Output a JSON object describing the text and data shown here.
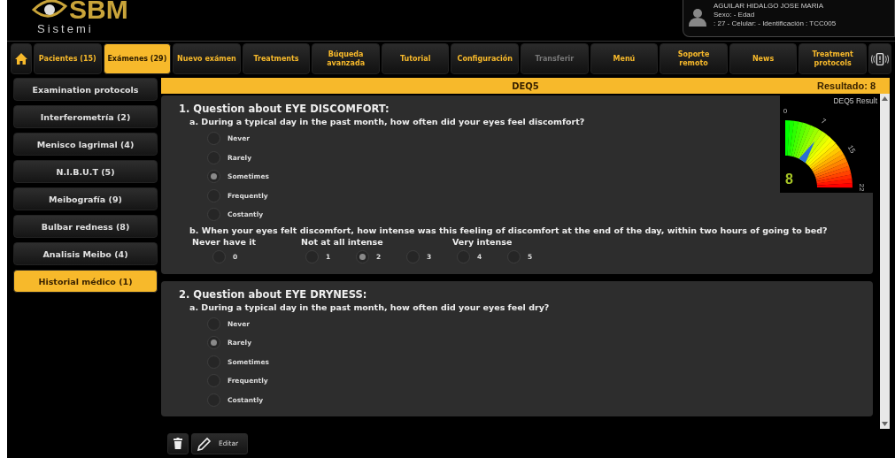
{
  "logo": {
    "name": "SBM",
    "subtitle": "Sistemi"
  },
  "patient": {
    "name": "AGUILAR HIDALGO JOSE MARIA",
    "lines": [
      "Sexo:  - Edad",
      ": 27 - Celular:  - Identificación : TCC005"
    ]
  },
  "nav": [
    {
      "kind": "home",
      "selected": false
    },
    {
      "kind": "text",
      "label": "Pacientes (15)",
      "selected": false,
      "disabled": false
    },
    {
      "kind": "text",
      "label": "Exámenes  (29)",
      "selected": true,
      "disabled": false
    },
    {
      "kind": "text",
      "label": "Nuevo exámen",
      "selected": false,
      "disabled": false
    },
    {
      "kind": "text",
      "label": "Treatments",
      "selected": false,
      "disabled": false
    },
    {
      "kind": "text",
      "label": "Búqueda avanzada",
      "selected": false,
      "disabled": false
    },
    {
      "kind": "text",
      "label": "Tutorial",
      "selected": false,
      "disabled": false
    },
    {
      "kind": "text",
      "label": "Configuración",
      "selected": false,
      "disabled": false
    },
    {
      "kind": "text",
      "label": "Transferir",
      "selected": false,
      "disabled": true
    },
    {
      "kind": "text",
      "label": "Menú",
      "selected": false,
      "disabled": false
    },
    {
      "kind": "text",
      "label": "Soporte remoto",
      "selected": false,
      "disabled": false
    },
    {
      "kind": "text",
      "label": "News",
      "selected": false,
      "disabled": false
    },
    {
      "kind": "text",
      "label": "Treatment protocols",
      "selected": false,
      "disabled": false
    },
    {
      "kind": "phone",
      "selected": false
    }
  ],
  "sidebar": {
    "items": [
      {
        "label": "Examination protocols",
        "selected": false
      },
      {
        "label": "Interferometría (2)",
        "selected": false
      },
      {
        "label": "Menisco lagrimal (4)",
        "selected": false
      },
      {
        "label": "N.I.B.U.T (5)",
        "selected": false
      },
      {
        "label": "Meibografía (9)",
        "selected": false
      },
      {
        "label": "Bulbar redness (8)",
        "selected": false
      },
      {
        "label": "Analisis Meibo (4)",
        "selected": false
      },
      {
        "label": "Historial médico (1)",
        "selected": true
      }
    ]
  },
  "exam": {
    "title": "DEQ5",
    "result": "Resultado: 8",
    "gauge": {
      "title": "DEQ5 Result",
      "value": "8",
      "ticks": [
        "0",
        "7",
        "15",
        "22"
      ]
    }
  },
  "questions": [
    {
      "title": "1. Question about EYE DISCOMFORT:",
      "parts": [
        {
          "kind": "list",
          "text": "a. During a typical day in the past month, how often did your eyes feel discomfort?",
          "options": [
            {
              "label": "Never",
              "selected": false
            },
            {
              "label": "Rarely",
              "selected": false
            },
            {
              "label": "Sometimes",
              "selected": true
            },
            {
              "label": "Frequently",
              "selected": false
            },
            {
              "label": "Costantly",
              "selected": false
            }
          ]
        },
        {
          "kind": "scale",
          "text": "b. When your eyes felt discomfort, how intense was this feeling of discomfort at the end of the day, within two hours of going to bed?",
          "options": [
            {
              "label": "0",
              "anchor": "Never have it",
              "selected": false
            },
            {
              "label": "1",
              "anchor": "Not at all intense",
              "selected": false
            },
            {
              "label": "2",
              "selected": true
            },
            {
              "label": "3",
              "selected": false
            },
            {
              "label": "4",
              "anchor": "Very intense",
              "selected": false
            },
            {
              "label": "5",
              "selected": false
            }
          ]
        }
      ]
    },
    {
      "title": "2. Question about EYE DRYNESS:",
      "parts": [
        {
          "kind": "list",
          "text": "a. During a typical day in the past month, how often did your eyes feel dry?",
          "options": [
            {
              "label": "Never",
              "selected": false
            },
            {
              "label": "Rarely",
              "selected": true
            },
            {
              "label": "Sometimes",
              "selected": false
            },
            {
              "label": "Frequently",
              "selected": false
            },
            {
              "label": "Costantly",
              "selected": false
            }
          ]
        }
      ]
    }
  ],
  "toolbar": {
    "edit": "Editar"
  }
}
